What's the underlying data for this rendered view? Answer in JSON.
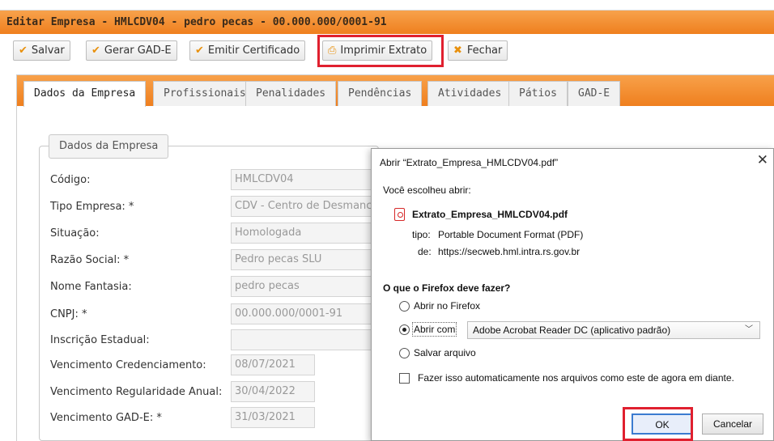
{
  "window": {
    "title": "Editar Empresa - HMLCDV04 - pedro pecas - 00.000.000/0001-91"
  },
  "toolbar": {
    "salvar": "Salvar",
    "gerar_gad": "Gerar GAD-E",
    "emitir": "Emitir Certificado",
    "imprimir": "Imprimir Extrato",
    "fechar": "Fechar"
  },
  "tabs": [
    {
      "label": "Dados da Empresa"
    },
    {
      "label": "Profissionais"
    },
    {
      "label": "Penalidades"
    },
    {
      "label": "Pendências"
    },
    {
      "label": "Atividades"
    },
    {
      "label": "Pátios"
    },
    {
      "label": "GAD-E"
    }
  ],
  "form": {
    "legend": "Dados da Empresa",
    "fields": [
      {
        "label": "Código:",
        "value": "HMLCDV04"
      },
      {
        "label": "Tipo Empresa: *",
        "value": "CDV - Centro de Desmanche"
      },
      {
        "label": "Situação:",
        "value": "Homologada"
      },
      {
        "label": "Razão Social: *",
        "value": "Pedro pecas SLU"
      },
      {
        "label": "Nome Fantasia:",
        "value": "pedro pecas"
      },
      {
        "label": "CNPJ: *",
        "value": "00.000.000/0001-91"
      },
      {
        "label": "Inscrição Estadual:",
        "value": ""
      },
      {
        "label": "Vencimento Credenciamento:",
        "value": "08/07/2021"
      },
      {
        "label": "Vencimento Regularidade Anual:",
        "value": "30/04/2022"
      },
      {
        "label": "Vencimento GAD-E: *",
        "value": "31/03/2021"
      }
    ]
  },
  "dialog": {
    "title": "Abrir “Extrato_Empresa_HMLCDV04.pdf”",
    "close": "✕",
    "chose_open": "Você escolheu abrir:",
    "filename": "Extrato_Empresa_HMLCDV04.pdf",
    "type_label": "tipo:",
    "type_value": "Portable Document Format (PDF)",
    "from_label": "de:",
    "from_value": "https://secweb.hml.intra.rs.gov.br",
    "question": "O que o Firefox deve fazer?",
    "option_firefox": "Abrir no Firefox",
    "option_open_with": "Abrir com",
    "open_with_app": "Adobe Acrobat Reader DC (aplicativo padrão)",
    "option_save": "Salvar arquivo",
    "auto_checkbox": "Fazer isso automaticamente nos arquivos como este de agora em diante.",
    "ok": "OK",
    "cancel": "Cancelar"
  },
  "colors": {
    "accent": "#ef7f1e",
    "highlight": "#e0202f",
    "ok_border": "#3b7bd0"
  }
}
